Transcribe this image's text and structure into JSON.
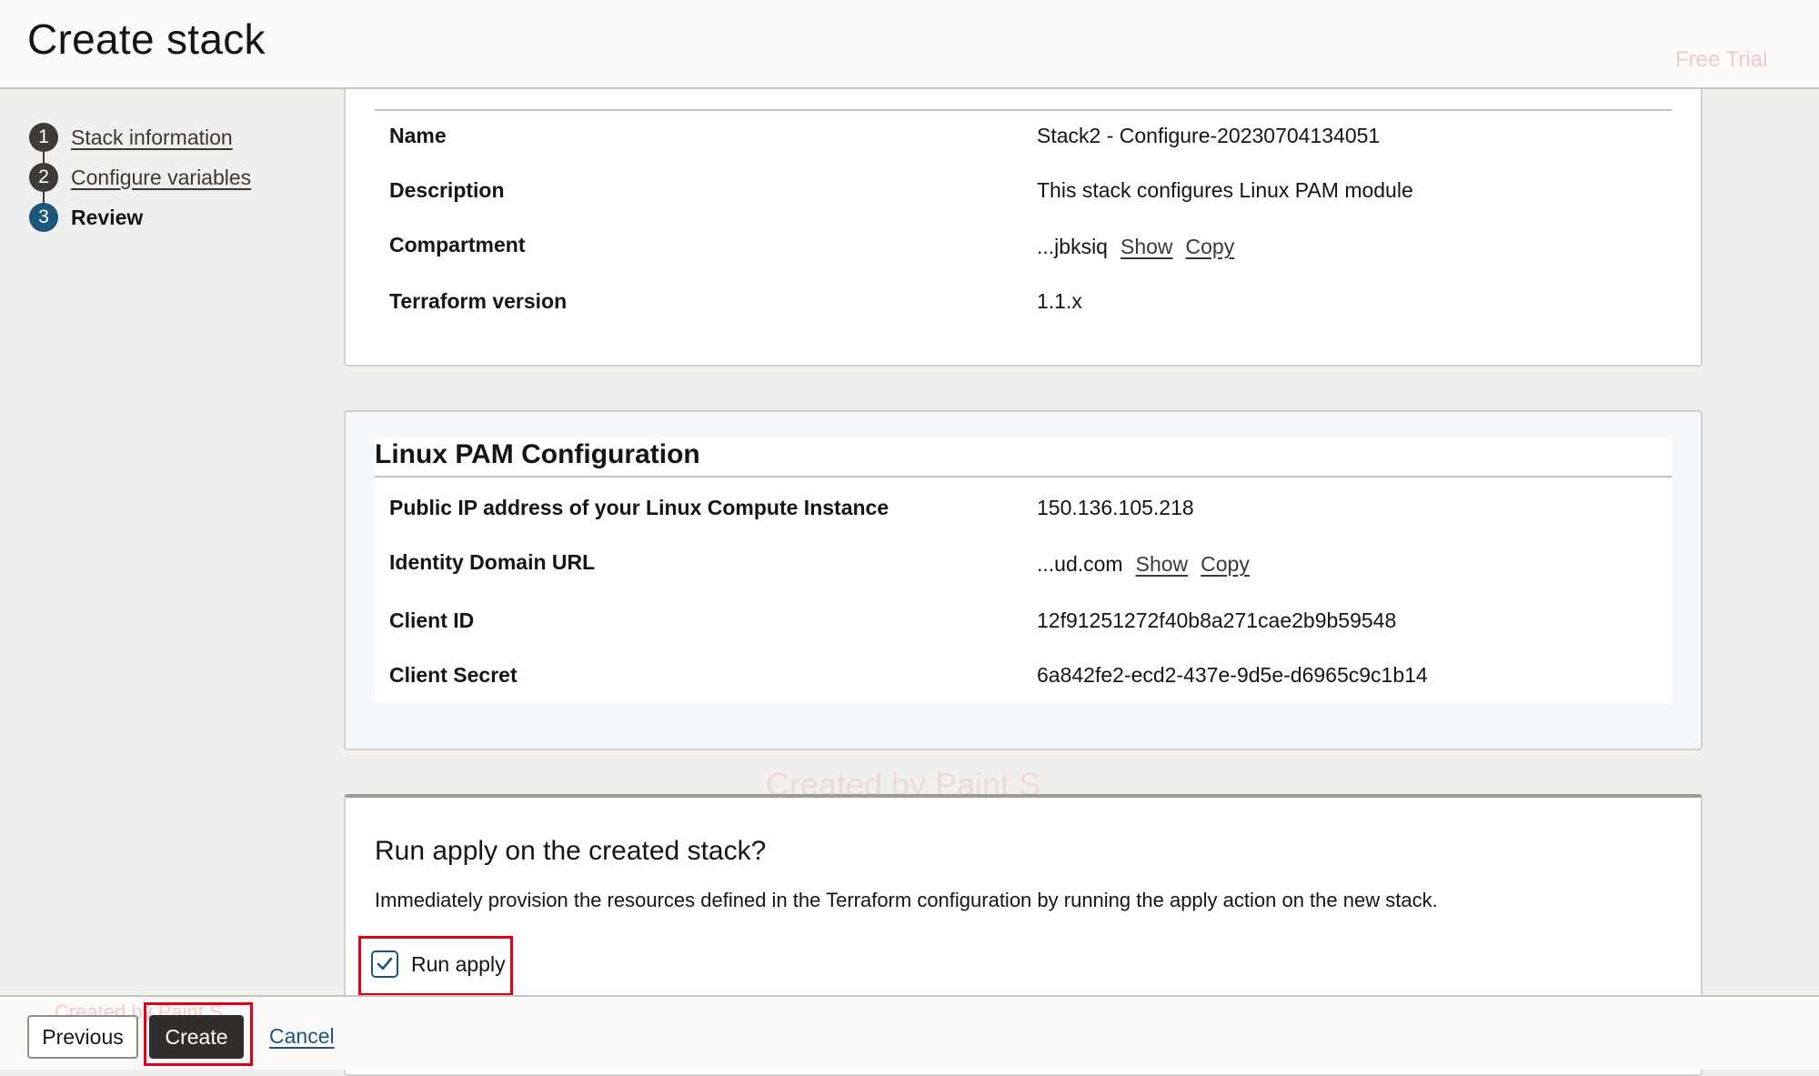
{
  "header": {
    "title": "Create stack",
    "trial_badge": "Free Trial"
  },
  "steps": [
    {
      "number": "1",
      "label": "Stack information"
    },
    {
      "number": "2",
      "label": "Configure variables"
    },
    {
      "number": "3",
      "label": "Review",
      "active": true
    }
  ],
  "stack_info": {
    "name_label": "Name",
    "name_value": "Stack2 - Configure-20230704134051",
    "description_label": "Description",
    "description_value": "This stack configures Linux PAM module",
    "compartment_label": "Compartment",
    "compartment_value": "...jbksiq",
    "terraform_label": "Terraform version",
    "terraform_value": "1.1.x"
  },
  "pam_config": {
    "title": "Linux PAM Configuration",
    "ip_label": "Public IP address of your Linux Compute Instance",
    "ip_value": "150.136.105.218",
    "domain_label": "Identity Domain URL",
    "domain_value": "...ud.com",
    "client_id_label": "Client ID",
    "client_id_value": "12f91251272f40b8a271cae2b9b59548",
    "client_secret_label": "Client Secret",
    "client_secret_value": "6a842fe2-ecd2-437e-9d5e-d6965c9c1b14"
  },
  "links": {
    "show": "Show",
    "copy": "Copy"
  },
  "run_apply": {
    "title": "Run apply on the created stack?",
    "description": "Immediately provision the resources defined in the Terraform configuration by running the apply action on the new stack.",
    "checkbox_label": "Run apply",
    "checked": true
  },
  "footer": {
    "previous_label": "Previous",
    "create_label": "Create",
    "cancel_label": "Cancel"
  },
  "watermark": {
    "text": "Created by Paint S"
  },
  "colors": {
    "accent": "#1c5679",
    "primary_button": "#312d2a",
    "highlight": "#e00019"
  }
}
